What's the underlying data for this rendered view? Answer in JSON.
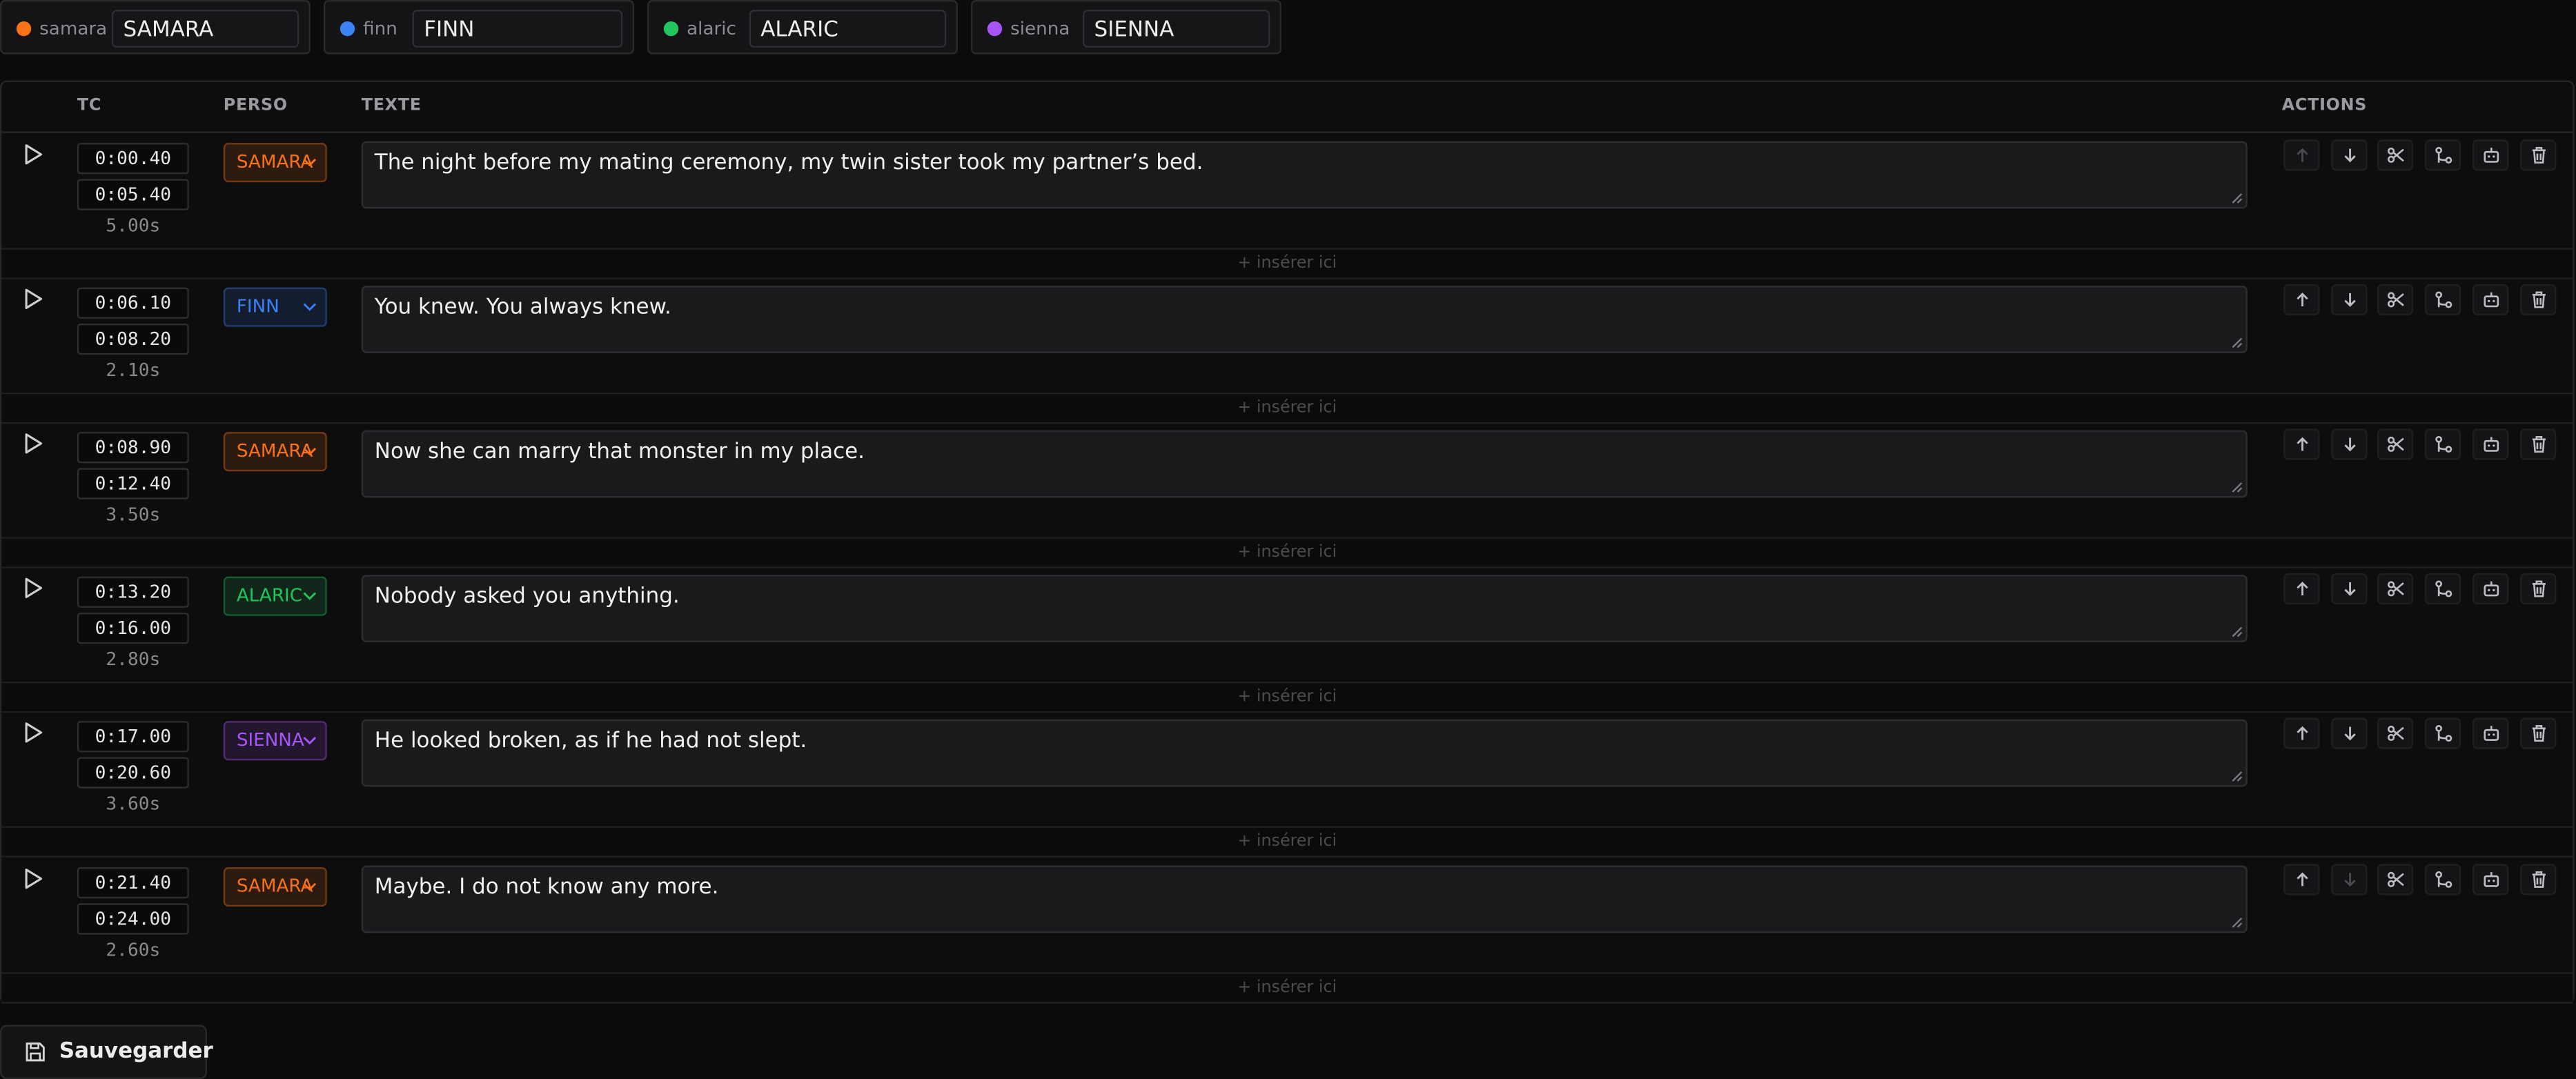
{
  "speakers": [
    {
      "key": "samara",
      "name": "SAMARA",
      "color": "#f97316"
    },
    {
      "key": "finn",
      "name": "FINN",
      "color": "#3b82f6"
    },
    {
      "key": "alaric",
      "name": "ALARIC",
      "color": "#22c55e"
    },
    {
      "key": "sienna",
      "name": "SIENNA",
      "color": "#a855f7"
    }
  ],
  "columns": {
    "tc": "TC",
    "perso": "PERSO",
    "texte": "TEXTE",
    "actions": "ACTIONS"
  },
  "insert_label": "+ insérer ici",
  "rows": [
    {
      "start": "0:00.40",
      "end": "0:05.40",
      "duration": "5.00s",
      "perso": "SAMARA",
      "color": "#f97316",
      "text": "The night before my mating ceremony, my twin sister took my partner’s bed."
    },
    {
      "start": "0:06.10",
      "end": "0:08.20",
      "duration": "2.10s",
      "perso": "FINN",
      "color": "#3b82f6",
      "text": "You knew. You always knew."
    },
    {
      "start": "0:08.90",
      "end": "0:12.40",
      "duration": "3.50s",
      "perso": "SAMARA",
      "color": "#f97316",
      "text": "Now she can marry that monster in my place."
    },
    {
      "start": "0:13.20",
      "end": "0:16.00",
      "duration": "2.80s",
      "perso": "ALARIC",
      "color": "#22c55e",
      "text": "Nobody asked you anything."
    },
    {
      "start": "0:17.00",
      "end": "0:20.60",
      "duration": "3.60s",
      "perso": "SIENNA",
      "color": "#a855f7",
      "text": "He looked broken, as if he had not slept."
    },
    {
      "start": "0:21.40",
      "end": "0:24.00",
      "duration": "2.60s",
      "perso": "SAMARA",
      "color": "#f97316",
      "text": "Maybe. I do not know any more."
    }
  ],
  "row_actions": [
    "move-up-icon",
    "move-down-icon",
    "scissors-icon",
    "merge-icon",
    "robot-icon",
    "trash-icon"
  ],
  "save_label": "Sauvegarder"
}
